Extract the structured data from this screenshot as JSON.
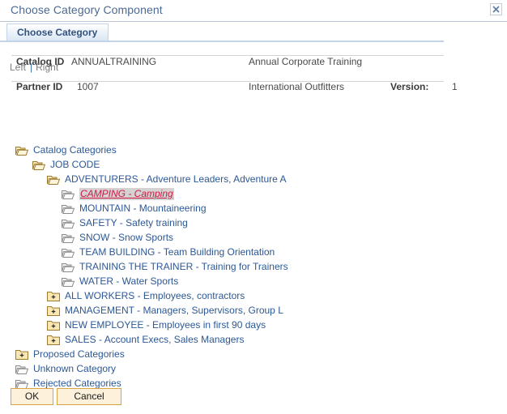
{
  "window": {
    "title": "Choose Category Component",
    "close_icon": "close-icon",
    "close_glyph": "×"
  },
  "tabs": [
    {
      "label": "Choose Category",
      "active": true
    }
  ],
  "detail": {
    "catalog_id_label": "Catalog ID",
    "catalog_id_value": "ANNUALTRAINING",
    "catalog_description": "Annual Corporate Training",
    "partner_id_label": "Partner ID",
    "partner_id_value": "1007",
    "partner_description": "International Outfitters",
    "version_label": "Version:",
    "version_value": "1"
  },
  "alignment": {
    "left_label": "Left",
    "separator": "|",
    "right_label": "Right"
  },
  "tree": {
    "nodes": [
      {
        "label": "Catalog Categories",
        "level": 1,
        "icon": "folder-open-icon",
        "selected": false
      },
      {
        "label": "JOB CODE",
        "level": 2,
        "icon": "folder-open-icon",
        "selected": false
      },
      {
        "label": "ADVENTURERS - Adventure Leaders, Adventure A",
        "level": 3,
        "icon": "folder-open-icon",
        "selected": false
      },
      {
        "label": "CAMPING - Camping",
        "level": 4,
        "icon": "folder-open-gray-icon",
        "selected": true
      },
      {
        "label": "MOUNTAIN - Mountaineering",
        "level": 4,
        "icon": "folder-open-gray-icon",
        "selected": false
      },
      {
        "label": "SAFETY - Safety training",
        "level": 4,
        "icon": "folder-open-gray-icon",
        "selected": false
      },
      {
        "label": "SNOW - Snow Sports",
        "level": 4,
        "icon": "folder-open-gray-icon",
        "selected": false
      },
      {
        "label": "TEAM BUILDING - Team Building Orientation",
        "level": 4,
        "icon": "folder-open-gray-icon",
        "selected": false
      },
      {
        "label": "TRAINING THE TRAINER - Training for Trainers",
        "level": 4,
        "icon": "folder-open-gray-icon",
        "selected": false
      },
      {
        "label": "WATER - Water Sports",
        "level": 4,
        "icon": "folder-open-gray-icon",
        "selected": false
      },
      {
        "label": "ALL WORKERS - Employees, contractors",
        "level": 3,
        "icon": "folder-plus-icon",
        "selected": false
      },
      {
        "label": "MANAGEMENT - Managers, Supervisors, Group L",
        "level": 3,
        "icon": "folder-plus-icon",
        "selected": false
      },
      {
        "label": "NEW EMPLOYEE - Employees in first 90 days",
        "level": 3,
        "icon": "folder-plus-icon",
        "selected": false
      },
      {
        "label": "SALES - Account Execs, Sales Managers",
        "level": 3,
        "icon": "folder-plus-icon",
        "selected": false
      },
      {
        "label": "Proposed Categories",
        "level": 1,
        "icon": "folder-plus-icon",
        "selected": false
      },
      {
        "label": "Unknown Category",
        "level": 1,
        "icon": "folder-open-gray-icon",
        "selected": false
      },
      {
        "label": "Rejected Categories",
        "level": 1,
        "icon": "folder-open-gray-icon",
        "selected": false
      }
    ]
  },
  "footer": {
    "ok_label": "OK",
    "cancel_label": "Cancel"
  },
  "colors": {
    "title_blue": "#4a6a94",
    "link_blue": "#2c5896",
    "selected_red": "#d01843",
    "selected_bg": "#d6d2d3",
    "tab_border": "#c3d3e8",
    "button_bg": "#fdf1dc",
    "button_border": "#d9a441",
    "folder_yellow": "#e8c46a",
    "folder_gray": "#9a9a9a"
  }
}
